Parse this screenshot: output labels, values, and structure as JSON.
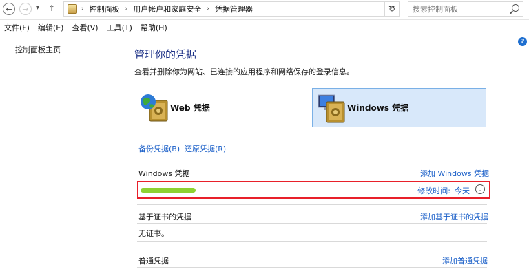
{
  "nav": {
    "back": "←",
    "forward": "→",
    "recent": "▾",
    "up": "↑"
  },
  "breadcrumb": [
    "控制面板",
    "用户帐户和家庭安全",
    "凭据管理器"
  ],
  "breadcrumb_sep": "›",
  "search": {
    "placeholder": "搜索控制面板"
  },
  "menu": [
    "文件(F)",
    "编辑(E)",
    "查看(V)",
    "工具(T)",
    "帮助(H)"
  ],
  "sidebar": {
    "home_link": "控制面板主页"
  },
  "help_label": "?",
  "page": {
    "title": "管理你的凭据",
    "subtitle": "查看并删除你为网站、已连接的应用程序和网络保存的登录信息。"
  },
  "cards": {
    "web": "Web 凭据",
    "windows": "Windows 凭据"
  },
  "actions": {
    "backup": "备份凭据(B)",
    "restore": "还原凭据(R)"
  },
  "sections": {
    "windows": {
      "title": "Windows 凭据",
      "add": "添加 Windows 凭据"
    },
    "certificate": {
      "title": "基于证书的凭据",
      "add": "添加基于证书的凭据",
      "empty": "无证书。"
    },
    "generic": {
      "title": "普通凭据",
      "add": "添加普通凭据"
    }
  },
  "credential": {
    "modified_label": "修改时间:",
    "modified_value": "今天",
    "expand_glyph": "⌄"
  },
  "colors": {
    "link": "#1a5fc8",
    "title": "#1e3287",
    "highlight_border": "#e8202a",
    "selected_card": "#d8e8fa"
  }
}
